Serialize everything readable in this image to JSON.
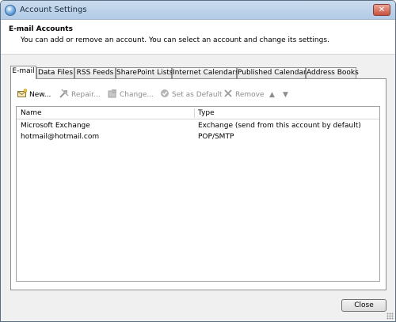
{
  "window": {
    "title": "Account Settings",
    "close_glyph": "✕"
  },
  "header": {
    "title": "E-mail Accounts",
    "subtitle": "You can add or remove an account. You can select an account and change its settings."
  },
  "tabs": [
    {
      "label": "E-mail",
      "active": true
    },
    {
      "label": "Data Files"
    },
    {
      "label": "RSS Feeds"
    },
    {
      "label": "SharePoint Lists"
    },
    {
      "label": "Internet Calendars"
    },
    {
      "label": "Published Calendars"
    },
    {
      "label": "Address Books"
    }
  ],
  "toolbar": {
    "new_label": "New...",
    "repair_label": "Repair...",
    "change_label": "Change...",
    "set_default_label": "Set as Default",
    "remove_label": "Remove",
    "move_up_glyph": "▲",
    "move_down_glyph": "▼"
  },
  "accounts_table": {
    "columns": [
      "Name",
      "Type"
    ],
    "rows": [
      {
        "name": "Microsoft Exchange",
        "type": "Exchange (send from this account by default)"
      },
      {
        "name": "hotmail@hotmail.com",
        "type": "POP/SMTP"
      }
    ]
  },
  "footer": {
    "close_label": "Close"
  },
  "colors": {
    "title_bar": "#b8cfe8",
    "close_red": "#c8523f",
    "disabled_text": "#8d8d8d"
  }
}
